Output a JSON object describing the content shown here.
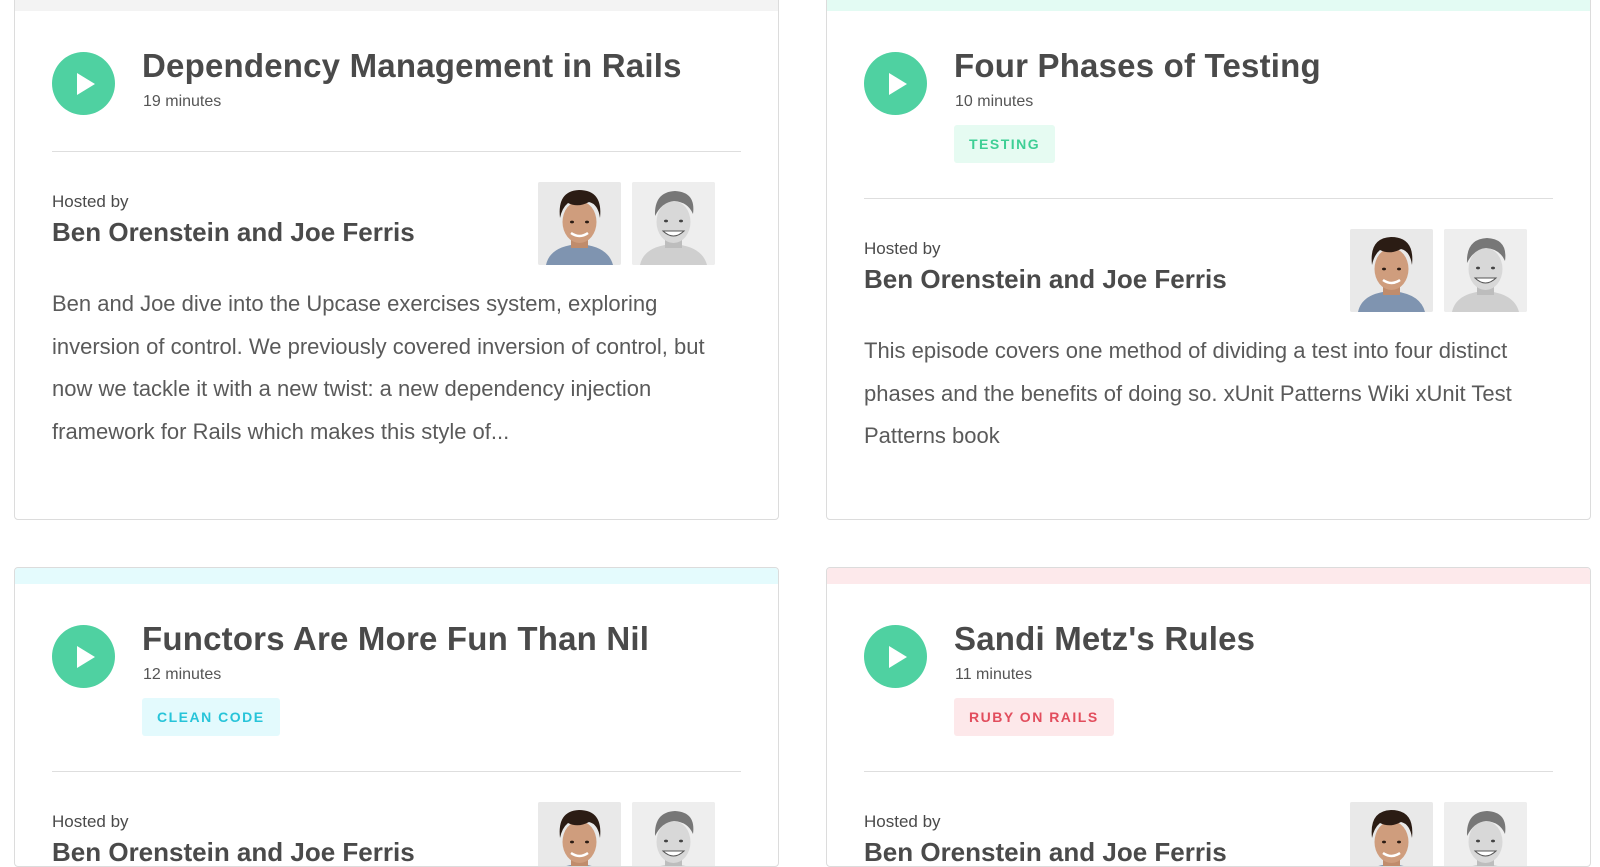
{
  "episodes": [
    {
      "title": "Dependency Management in Rails",
      "duration": "19 minutes",
      "hosted_by_label": "Hosted by",
      "hosts": "Ben Orenstein and Joe Ferris",
      "description": "Ben and Joe dive into the Upcase exercises system, exploring inversion of control. We previously covered inversion of control, but now we tackle it with a new twist: a new dependency injection framework for Rails which makes this style of...",
      "accent_color": "#f3f3f3"
    },
    {
      "title": "Four Phases of Testing",
      "duration": "10 minutes",
      "tag": "TESTING",
      "tag_color": "#3ecf95",
      "tag_background": "#e6fbf2",
      "hosted_by_label": "Hosted by",
      "hosts": "Ben Orenstein and Joe Ferris",
      "description": "This episode covers one method of dividing a test into four distinct phases and the benefits of doing so. xUnit Patterns Wiki xUnit Test Patterns book",
      "accent_color": "#e3fbf3"
    },
    {
      "title": "Functors Are More Fun Than Nil",
      "duration": "12 minutes",
      "tag": "CLEAN CODE",
      "tag_color": "#27c4d9",
      "tag_background": "#e3fafd",
      "hosted_by_label": "Hosted by",
      "hosts": "Ben Orenstein and Joe Ferris",
      "accent_color": "#e4fbfd"
    },
    {
      "title": "Sandi Metz's Rules",
      "duration": "11 minutes",
      "tag": "RUBY ON RAILS",
      "tag_color": "#e24d5d",
      "tag_background": "#fde8ea",
      "hosted_by_label": "Hosted by",
      "hosts": "Ben Orenstein and Joe Ferris",
      "accent_color": "#fde9eb"
    }
  ],
  "icons": {
    "play": "play-icon",
    "avatar_host_1": "host-ben-photo",
    "avatar_host_2": "host-joe-photo"
  },
  "colors": {
    "play_button": "#4fd1a1"
  }
}
